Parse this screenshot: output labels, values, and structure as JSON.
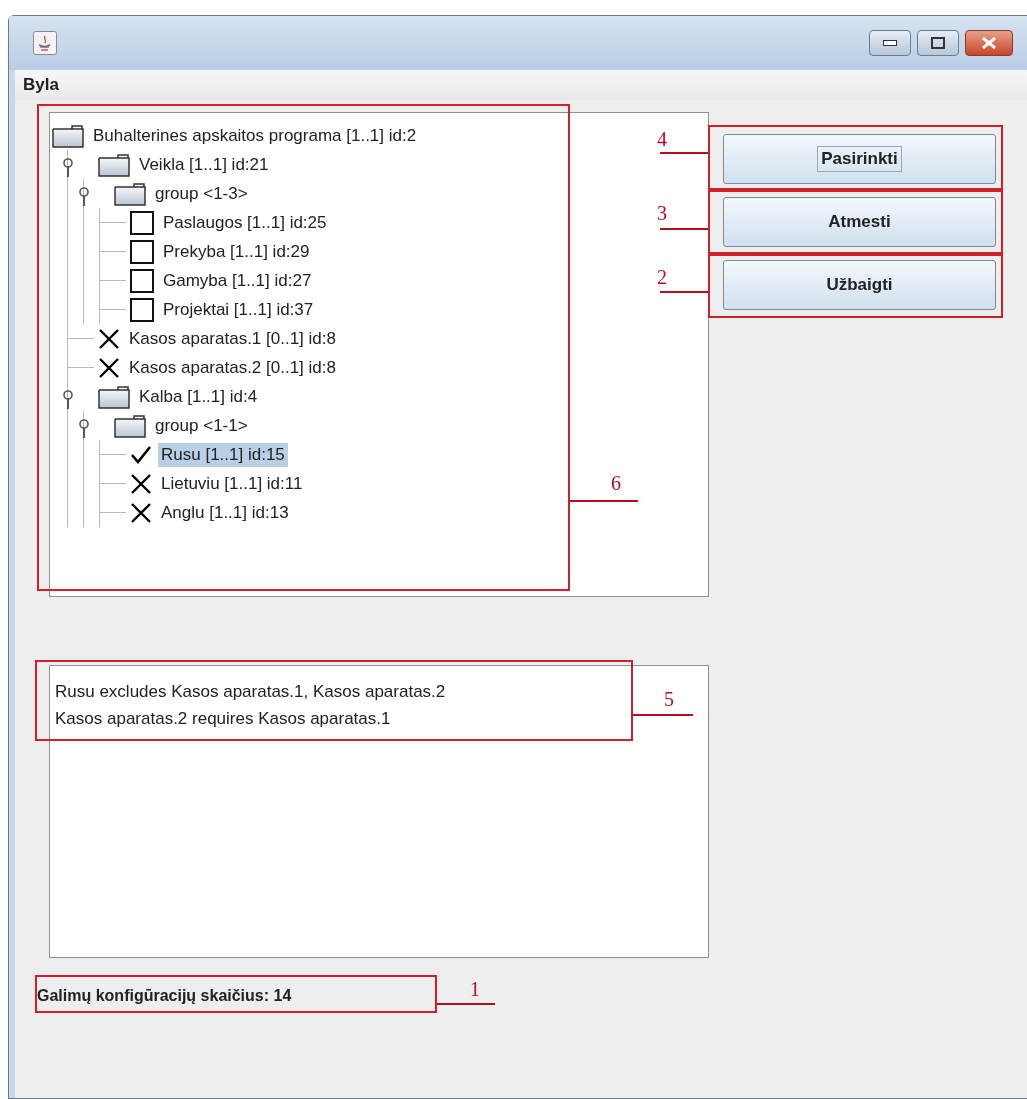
{
  "menu": [
    "Byla"
  ],
  "tree": {
    "label": "Buhalterines apskaitos programa [1..1] id:2",
    "kind": "folder",
    "selected": false,
    "children": [
      {
        "label": "Veikla [1..1] id:21",
        "kind": "folder",
        "expanded": true,
        "selected": false,
        "children": [
          {
            "label": "group <1-3>",
            "kind": "folder",
            "expanded": true,
            "selected": false,
            "children": [
              {
                "label": "Paslaugos [1..1] id:25",
                "kind": "open",
                "selected": false
              },
              {
                "label": "Prekyba [1..1] id:29",
                "kind": "open",
                "selected": false
              },
              {
                "label": "Gamyba [1..1] id:27",
                "kind": "open",
                "selected": false
              },
              {
                "label": "Projektai [1..1] id:37",
                "kind": "open",
                "selected": false
              }
            ]
          }
        ]
      },
      {
        "label": "Kasos aparatas.1 [0..1] id:8",
        "kind": "excluded",
        "selected": false
      },
      {
        "label": "Kasos aparatas.2 [0..1] id:8",
        "kind": "excluded",
        "selected": false
      },
      {
        "label": "Kalba [1..1] id:4",
        "kind": "folder",
        "expanded": true,
        "selected": false,
        "children": [
          {
            "label": "group <1-1>",
            "kind": "folder",
            "expanded": true,
            "selected": false,
            "children": [
              {
                "label": "Rusu [1..1] id:15",
                "kind": "included",
                "selected": true
              },
              {
                "label": "Lietuviu [1..1] id:11",
                "kind": "excluded",
                "selected": false
              },
              {
                "label": "Anglu [1..1] id:13",
                "kind": "excluded",
                "selected": false
              }
            ]
          }
        ]
      }
    ]
  },
  "buttons": [
    {
      "label": "Pasirinkti",
      "focused": true
    },
    {
      "label": "Atmesti",
      "focused": false
    },
    {
      "label": "Užbaigti",
      "focused": false
    }
  ],
  "messages": [
    "Rusu excludes Kasos aparatas.1, Kasos aparatas.2",
    "Kasos aparatas.2 requires Kasos aparatas.1"
  ],
  "status": "Galimų konfigūracijų skaičius: 14",
  "annotations": [
    {
      "number": "6"
    },
    {
      "number": "4"
    },
    {
      "number": "3"
    },
    {
      "number": "2"
    },
    {
      "number": "5"
    },
    {
      "number": "1"
    }
  ]
}
